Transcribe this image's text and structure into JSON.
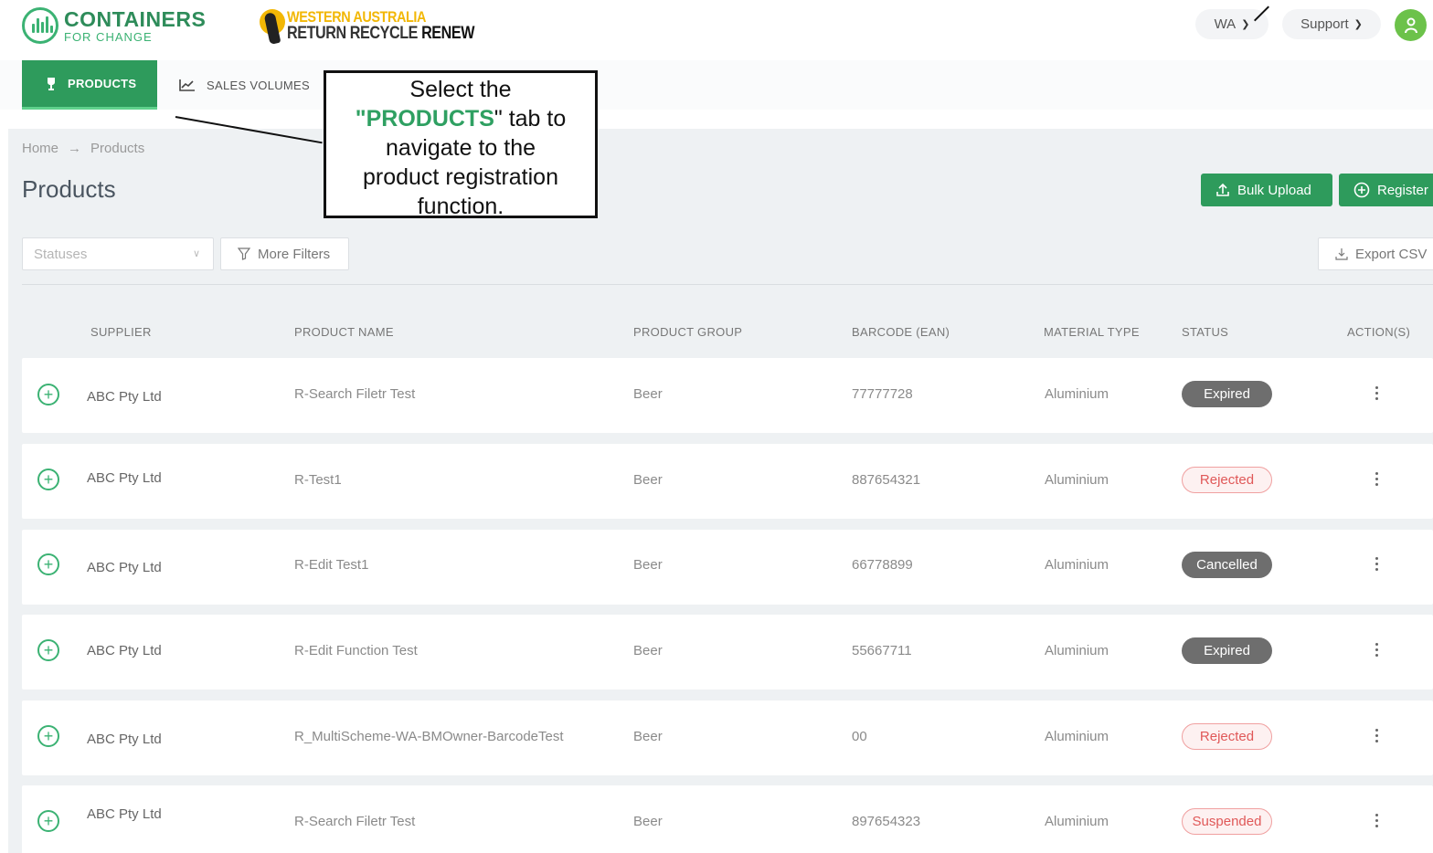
{
  "header": {
    "logo_main": "CONTAINERS",
    "logo_sub": "FOR CHANGE",
    "wa_line1": "WESTERN AUSTRALIA",
    "wa_line2": "RETURN RECYCLE",
    "wa_line2_bold": "RENEW",
    "region": "WA",
    "support": "Support"
  },
  "tabs": [
    {
      "label": "PRODUCTS",
      "icon": "bottle-icon",
      "active": true
    },
    {
      "label": "SALES VOLUMES",
      "icon": "chart-line-icon",
      "active": false
    }
  ],
  "breadcrumb": {
    "home": "Home",
    "separator": "→",
    "current": "Products"
  },
  "page_title": "Products",
  "actions": {
    "bulk_upload": "Bulk Upload",
    "register": "Register"
  },
  "filters": {
    "statuses_placeholder": "Statuses",
    "more_filters": "More Filters",
    "export_csv": "Export CSV"
  },
  "table": {
    "headers": [
      "SUPPLIER",
      "PRODUCT NAME",
      "PRODUCT GROUP",
      "BARCODE (EAN)",
      "MATERIAL TYPE",
      "STATUS",
      "ACTION(S)"
    ],
    "rows": [
      {
        "supplier": "ABC Pty Ltd",
        "product_name": "R-Search Filetr Test",
        "group": "Beer",
        "barcode": "77777728",
        "material": "Aluminium",
        "status": "Expired"
      },
      {
        "supplier": "ABC Pty Ltd",
        "product_name": "R-Test1",
        "group": "Beer",
        "barcode": "887654321",
        "material": "Aluminium",
        "status": "Rejected"
      },
      {
        "supplier": "ABC Pty Ltd",
        "product_name": "R-Edit Test1",
        "group": "Beer",
        "barcode": "66778899",
        "material": "Aluminium",
        "status": "Cancelled"
      },
      {
        "supplier": "ABC Pty Ltd",
        "product_name": "R-Edit Function Test",
        "group": "Beer",
        "barcode": "55667711",
        "material": "Aluminium",
        "status": "Expired"
      },
      {
        "supplier": "ABC Pty Ltd",
        "product_name": "R_MultiScheme-WA-BMOwner-BarcodeTest",
        "group": "Beer",
        "barcode": "00",
        "material": "Aluminium",
        "status": "Rejected"
      },
      {
        "supplier": "ABC Pty Ltd",
        "product_name": "R-Search Filetr Test",
        "group": "Beer",
        "barcode": "897654323",
        "material": "Aluminium",
        "status": "Suspended"
      }
    ]
  },
  "callout": {
    "line1": "Select the",
    "quote_open": "\"",
    "highlight": "PRODUCTS",
    "line2_rest": "\" tab to",
    "line3": "navigate to the",
    "line4": "product registration",
    "line5": "function."
  },
  "colors": {
    "brand_green": "#2e9b5c",
    "badge_grey": "#6e6e6e",
    "badge_red": "#e05858"
  }
}
